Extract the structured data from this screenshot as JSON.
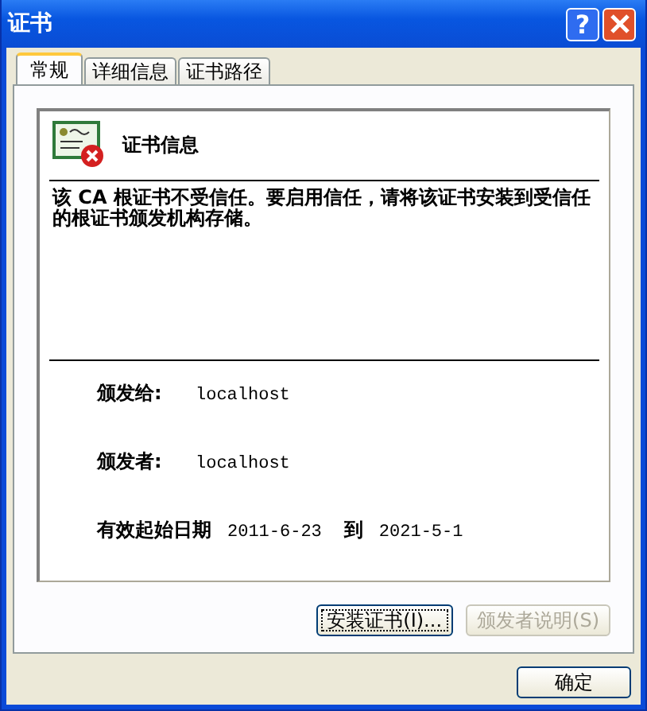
{
  "window": {
    "title": "证书",
    "help_label": "?"
  },
  "tabs": [
    {
      "label": "常规",
      "selected": true
    },
    {
      "label": "详细信息",
      "selected": false
    },
    {
      "label": "证书路径",
      "selected": false
    }
  ],
  "certificate": {
    "heading": "证书信息",
    "message": "该 CA 根证书不受信任。要启用信任，请将该证书安装到受信任的根证书颁发机构存储。",
    "fields": [
      {
        "label": "颁发给:",
        "value": "localhost"
      },
      {
        "label": "颁发者:",
        "value": "localhost"
      }
    ],
    "validity": {
      "label": "有效起始日期",
      "from": "2011-6-23",
      "separator": "到",
      "to": "2021-5-1"
    }
  },
  "panel_buttons": [
    {
      "label": "安装证书(I)...",
      "disabled": false,
      "focused": true
    },
    {
      "label": "颁发者说明(S)",
      "disabled": true,
      "focused": false
    }
  ],
  "ok_button": {
    "label": "确定"
  }
}
